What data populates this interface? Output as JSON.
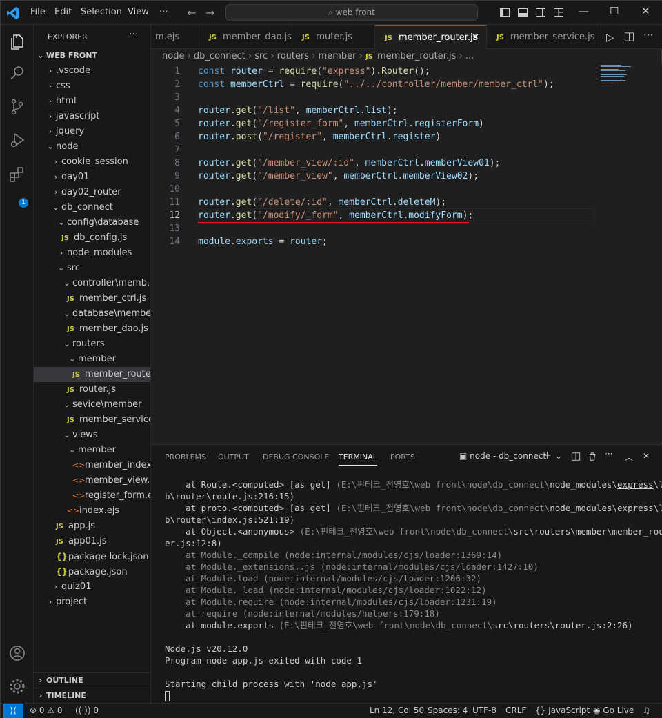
{
  "titlebar": {
    "menu": [
      "File",
      "Edit",
      "Selection",
      "View",
      "···"
    ],
    "search": "web front"
  },
  "explorer": {
    "title": "EXPLORER",
    "root": "WEB FRONT",
    "items": [
      {
        "label": ".vscode",
        "type": "folder",
        "depth": 1,
        "open": false
      },
      {
        "label": "css",
        "type": "folder",
        "depth": 1,
        "open": false
      },
      {
        "label": "html",
        "type": "folder",
        "depth": 1,
        "open": false
      },
      {
        "label": "javascript",
        "type": "folder",
        "depth": 1,
        "open": false
      },
      {
        "label": "jquery",
        "type": "folder",
        "depth": 1,
        "open": false
      },
      {
        "label": "node",
        "type": "folder",
        "depth": 1,
        "open": true
      },
      {
        "label": "cookie_session",
        "type": "folder",
        "depth": 2,
        "open": false
      },
      {
        "label": "day01",
        "type": "folder",
        "depth": 2,
        "open": false
      },
      {
        "label": "day02_router",
        "type": "folder",
        "depth": 2,
        "open": false
      },
      {
        "label": "db_connect",
        "type": "folder",
        "depth": 2,
        "open": true
      },
      {
        "label": "config\\database",
        "type": "folder",
        "depth": 3,
        "open": true
      },
      {
        "label": "db_config.js",
        "type": "js",
        "depth": 4
      },
      {
        "label": "node_modules",
        "type": "folder",
        "depth": 3,
        "open": false
      },
      {
        "label": "src",
        "type": "folder",
        "depth": 3,
        "open": true
      },
      {
        "label": "controller\\memb...",
        "type": "folder",
        "depth": 4,
        "open": true
      },
      {
        "label": "member_ctrl.js",
        "type": "js",
        "depth": 5
      },
      {
        "label": "database\\member",
        "type": "folder",
        "depth": 4,
        "open": true
      },
      {
        "label": "member_dao.js",
        "type": "js",
        "depth": 5
      },
      {
        "label": "routers",
        "type": "folder",
        "depth": 4,
        "open": true
      },
      {
        "label": "member",
        "type": "folder",
        "depth": 5,
        "open": true
      },
      {
        "label": "member_route...",
        "type": "js",
        "depth": 6,
        "selected": true
      },
      {
        "label": "router.js",
        "type": "js",
        "depth": 5
      },
      {
        "label": "sevice\\member",
        "type": "folder",
        "depth": 4,
        "open": true
      },
      {
        "label": "member_service...",
        "type": "js",
        "depth": 5
      },
      {
        "label": "views",
        "type": "folder",
        "depth": 4,
        "open": true
      },
      {
        "label": "member",
        "type": "folder",
        "depth": 5,
        "open": true
      },
      {
        "label": "member_index...",
        "type": "ejs",
        "depth": 6
      },
      {
        "label": "member_view....",
        "type": "ejs",
        "depth": 6
      },
      {
        "label": "register_form.ejs",
        "type": "ejs",
        "depth": 6
      },
      {
        "label": "index.ejs",
        "type": "ejs",
        "depth": 5
      },
      {
        "label": "app.js",
        "type": "js",
        "depth": 3
      },
      {
        "label": "app01.js",
        "type": "js",
        "depth": 3
      },
      {
        "label": "package-lock.json",
        "type": "json",
        "depth": 3
      },
      {
        "label": "package.json",
        "type": "json",
        "depth": 3
      },
      {
        "label": "quiz01",
        "type": "folder",
        "depth": 2,
        "open": false
      },
      {
        "label": "project",
        "type": "folder",
        "depth": 1,
        "open": false
      }
    ],
    "outline": "OUTLINE",
    "timeline": "TIMELINE"
  },
  "tabs": [
    {
      "label": "m.ejs",
      "icon": "",
      "active": false
    },
    {
      "label": "member_dao.js",
      "icon": "JS",
      "active": false
    },
    {
      "label": "router.js",
      "icon": "JS",
      "active": false
    },
    {
      "label": "member_router.js",
      "icon": "JS",
      "active": true
    },
    {
      "label": "member_service.js",
      "icon": "JS",
      "active": false
    }
  ],
  "breadcrumb": [
    "node",
    "db_connect",
    "src",
    "routers",
    "member",
    "member_router.js",
    "..."
  ],
  "badge_count": "1",
  "editor": {
    "current_line": 12,
    "lines": [
      "const router = require(\"express\").Router();",
      "const memberCtrl = require(\"../../controller/member/member_ctrl\");",
      "",
      "router.get(\"/list\", memberCtrl.list);",
      "router.get(\"/register_form\", memberCtrl.registerForm)",
      "router.post(\"/register\", memberCtrl.register)",
      "",
      "router.get(\"/member_view/:id\", memberCtrl.memberView01);",
      "router.get(\"/member_view\", memberCtrl.memberView02);",
      "",
      "router.get(\"/delete/:id\", memberCtrl.deleteM);",
      "router.get(\"/modify/_form\", memberCtrl.modifyForm);",
      "",
      "module.exports = router;"
    ]
  },
  "panel": {
    "tabs": [
      "PROBLEMS",
      "OUTPUT",
      "DEBUG CONSOLE",
      "TERMINAL",
      "PORTS"
    ],
    "active_tab": "TERMINAL",
    "terminal_name": "node - db_connect",
    "lines": [
      "    at Route.<computed> [as get] (E:\\핀테크_전영호\\web front\\node\\db_connect\\node_modules\\express\\li",
      "b\\router\\route.js:216:15)",
      "    at proto.<computed> [as get] (E:\\핀테크_전영호\\web front\\node\\db_connect\\node_modules\\express\\li",
      "b\\router\\index.js:521:19)",
      "    at Object.<anonymous> (E:\\핀테크_전영호\\web front\\node\\db_connect\\src\\routers\\member\\member_rout",
      "er.js:12:8)",
      "    at Module._compile (node:internal/modules/cjs/loader:1369:14)",
      "    at Module._extensions..js (node:internal/modules/cjs/loader:1427:10)",
      "    at Module.load (node:internal/modules/cjs/loader:1206:32)",
      "    at Module._load (node:internal/modules/cjs/loader:1022:12)",
      "    at Module.require (node:internal/modules/cjs/loader:1231:19)",
      "    at require (node:internal/modules/helpers:179:18)",
      "    at module.exports (E:\\핀테크_전영호\\web front\\node\\db_connect\\src\\routers\\router.js:2:26)",
      "",
      "Node.js v20.12.0",
      "Program node app.js exited with code 1",
      "",
      "Starting child process with 'node app.js'"
    ]
  },
  "status": {
    "errors": "0",
    "warnings": "0",
    "ports": "0",
    "position": "Ln 12, Col 50",
    "spaces": "Spaces: 4",
    "encoding": "UTF-8",
    "eol": "CRLF",
    "language": "JavaScript",
    "golive": "Go Live"
  }
}
